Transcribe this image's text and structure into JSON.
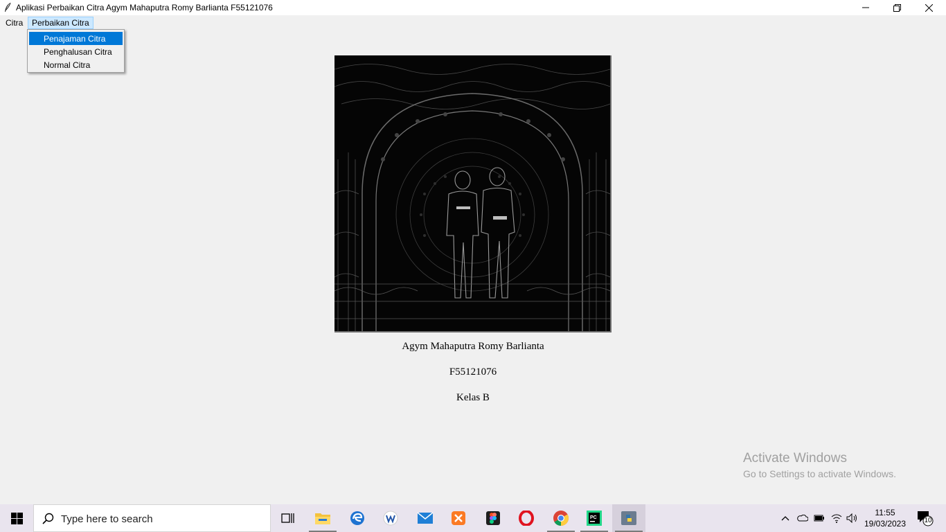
{
  "window": {
    "title": "Aplikasi Perbaikan Citra Agym Mahaputra Romy Barlianta F55121076",
    "icon": "feather-icon"
  },
  "menubar": {
    "items": [
      {
        "label": "Citra"
      },
      {
        "label": "Perbaikan Citra"
      }
    ]
  },
  "dropdown": {
    "items": [
      {
        "label": "Penajaman Citra",
        "highlighted": true
      },
      {
        "label": "Penghalusan Citra",
        "highlighted": false
      },
      {
        "label": "Normal Citra",
        "highlighted": false
      }
    ]
  },
  "content": {
    "image_description_icon": "edge-detected-photo",
    "name": "Agym Mahaputra Romy Barlianta",
    "student_id": "F55121076",
    "class": "Kelas B"
  },
  "watermark": {
    "title": "Activate Windows",
    "subtitle": "Go to Settings to activate Windows."
  },
  "taskbar": {
    "search_placeholder": "Type here to search",
    "apps": [
      "task-view-icon",
      "file-explorer-icon",
      "edge-icon",
      "wps-writer-icon",
      "mail-icon",
      "xampp-icon",
      "figma-icon",
      "opera-icon",
      "chrome-icon",
      "pycharm-icon",
      "python-icon"
    ],
    "time": "11:55",
    "date": "19/03/2023",
    "notification_count": "10"
  },
  "colors": {
    "highlight": "#0078d7",
    "menu_hover": "#cce8ff",
    "background": "#f0f0f0"
  }
}
